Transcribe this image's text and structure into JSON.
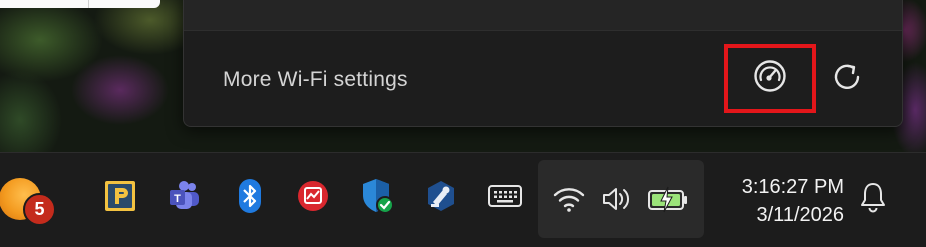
{
  "flyout": {
    "more_settings_label": "More Wi-Fi settings",
    "speed_test_icon": "speedometer-icon",
    "refresh_icon": "refresh-icon",
    "highlight_color": "#e3161a"
  },
  "taskbar": {
    "notification_badge": "5",
    "pinned_icons": [
      "weather-sun-icon",
      "p-app-icon",
      "teams-icon",
      "bluetooth-icon",
      "red-app-icon",
      "security-shield-icon",
      "remote-tool-icon",
      "keyboard-icon"
    ],
    "tray_icons": [
      "wifi-icon",
      "volume-icon",
      "battery-charging-icon"
    ],
    "clock": {
      "time": "3:16:27 PM",
      "date": "3/11/2026"
    },
    "bell_icon": "notification-bell-icon"
  }
}
